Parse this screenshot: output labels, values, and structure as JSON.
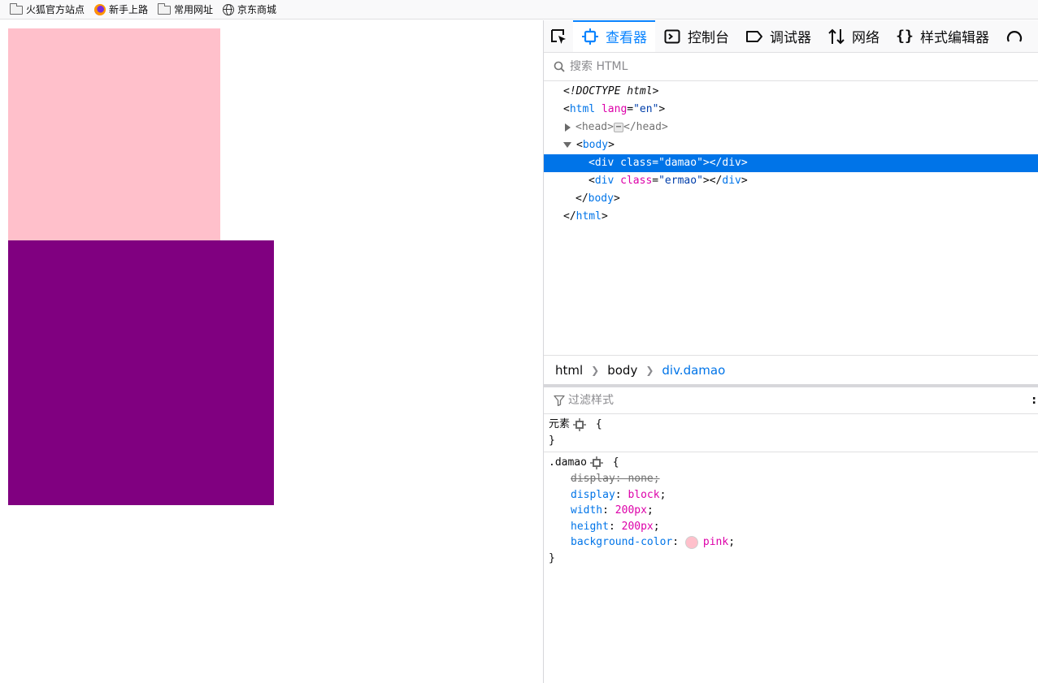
{
  "bookmarks": [
    {
      "label": "火狐官方站点",
      "icon": "folder-icon"
    },
    {
      "label": "新手上路",
      "icon": "firefox-icon"
    },
    {
      "label": "常用网址",
      "icon": "folder-icon"
    },
    {
      "label": "京东商城",
      "icon": "globe-icon"
    }
  ],
  "page": {
    "damao_color": "pink",
    "ermao_color": "purple"
  },
  "devtools": {
    "tabs": {
      "inspector": "查看器",
      "console": "控制台",
      "debugger": "调试器",
      "network": "网络",
      "style_editor": "样式编辑器"
    },
    "search_placeholder": "搜索 HTML",
    "markup": {
      "doctype": "<!DOCTYPE html>",
      "html_open_tag": "html",
      "lang_attr": "lang",
      "lang_val": "\"en\"",
      "head_tag": "head",
      "body_tag": "body",
      "div_tag": "div",
      "class_attr": "class",
      "damao_val": "\"damao\"",
      "ermao_val": "\"ermao\""
    },
    "breadcrumbs": [
      "html",
      "body",
      "div.damao"
    ],
    "filter_placeholder": "过滤样式",
    "rules": {
      "element_label": "元素",
      "damao_selector": ".damao",
      "props": [
        {
          "name": "display",
          "value": "none",
          "overridden": true
        },
        {
          "name": "display",
          "value": "block",
          "overridden": false
        },
        {
          "name": "width",
          "value": "200px",
          "overridden": false
        },
        {
          "name": "height",
          "value": "200px",
          "overridden": false
        },
        {
          "name": "background-color",
          "value": "pink",
          "overridden": false
        }
      ]
    }
  }
}
